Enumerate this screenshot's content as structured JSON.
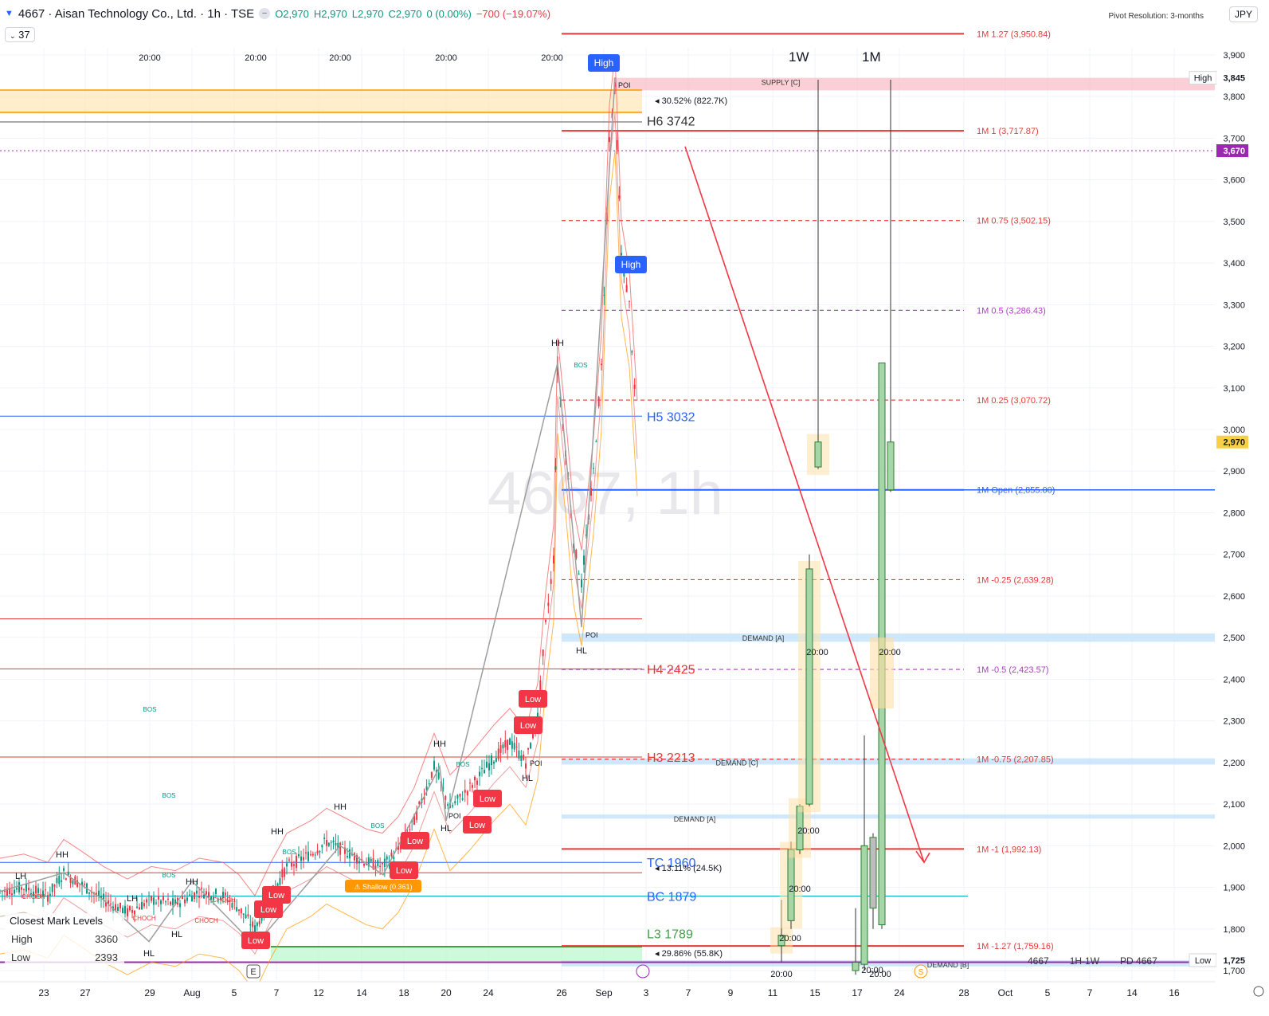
{
  "header": {
    "symbol": "4667 · Aisan Technology Co., Ltd. · 1h · TSE",
    "open": "O2,970",
    "high": "H2,970",
    "low": "L2,970",
    "close": "C2,970",
    "change": "0 (0.00%)",
    "volume_change": "−700 (−19.07%)",
    "indicator_count": "37",
    "pivot_resolution": "Pivot Resolution: 3-months",
    "currency": "JPY"
  },
  "timeframe_labels": [
    "1W",
    "1M"
  ],
  "watermark": "4667, 1h",
  "colors": {
    "up": "#089981",
    "down": "#f23645",
    "pivot_red": "#e53935",
    "pivot_purple": "#b03bc4",
    "open_blue": "#2962ff",
    "price_tag": "#f7d046"
  },
  "price_levels": [
    {
      "label": "1M 1.27 (3,950.84)",
      "price": 3950.84,
      "color": "#e53935",
      "style": "solid"
    },
    {
      "label": "1M 1 (3,717.87)",
      "price": 3717.87,
      "color": "#e53935",
      "style": "solid"
    },
    {
      "label": "1M 0.75 (3,502.15)",
      "price": 3502.15,
      "color": "#e53935",
      "style": "dashed"
    },
    {
      "label": "1M 0.5 (3,286.43)",
      "price": 3286.43,
      "color": "#b03bc4",
      "style": "dashed"
    },
    {
      "label": "1M 0.25 (3,070.72)",
      "price": 3070.72,
      "color": "#e53935",
      "style": "dashed"
    },
    {
      "label": "1M Open (2,855.00)",
      "price": 2855.0,
      "color": "#2962ff",
      "style": "solid"
    },
    {
      "label": "1M -0.25 (2,639.28)",
      "price": 2639.28,
      "color": "#e53935",
      "style": "dashed"
    },
    {
      "label": "1M -0.5 (2,423.57)",
      "price": 2423.57,
      "color": "#b03bc4",
      "style": "dashed"
    },
    {
      "label": "1M -0.75 (2,207.85)",
      "price": 2207.85,
      "color": "#e53935",
      "style": "dashed"
    },
    {
      "label": "1M -1 (1,992.13)",
      "price": 1992.13,
      "color": "#e53935",
      "style": "solid"
    },
    {
      "label": "1M -1.27 (1,759.16)",
      "price": 1759.16,
      "color": "#e53935",
      "style": "solid"
    }
  ],
  "h_levels": [
    {
      "label": "H6 3742",
      "price": 3742,
      "color": "#333333"
    },
    {
      "label": "H5 3032",
      "price": 3032,
      "color": "#2962ff"
    },
    {
      "label": "H4 2425",
      "price": 2425,
      "color": "#e53935"
    },
    {
      "label": "H3 2213",
      "price": 2213,
      "color": "#e53935"
    },
    {
      "label": "TC 1960",
      "price": 1960,
      "color": "#2962ff"
    },
    {
      "label": "BC 1879",
      "price": 1879,
      "color": "#2962ff"
    },
    {
      "label": "L3 1789",
      "price": 1789,
      "color": "#43a047"
    }
  ],
  "zones": [
    {
      "label": "SUPPLY [C]",
      "top": 3845,
      "bottom": 3815,
      "color": "#f8bbc4"
    },
    {
      "label": "DEMAND [A]",
      "top": 2510,
      "bottom": 2490,
      "color": "#bbdefb"
    },
    {
      "label": "DEMAND [C]",
      "top": 2210,
      "bottom": 2195,
      "color": "#bbdefb"
    },
    {
      "label": "DEMAND [A]",
      "top": 2075,
      "bottom": 2065,
      "color": "#bbdefb"
    },
    {
      "label": "DEMAND [B]",
      "top": 1725,
      "bottom": 1710,
      "color": "#bbdefb"
    }
  ],
  "annotations": {
    "pct_top": "◂ 30.52% (822.7K)",
    "pct_mid": "◂ 13.11% (24.5K)",
    "pct_bottom": "◂ 29.86% (55.8K)",
    "high_tag_1": "High",
    "high_tag_2": "High",
    "poi": "POI",
    "shallow": "⚠ Shallow (0.361)",
    "low_tag": "Low",
    "structure": [
      "HH",
      "HL",
      "LH",
      "BOS",
      "CHOCH"
    ]
  },
  "structure_labels": [
    {
      "text": "HH",
      "x": 700,
      "y": 434
    },
    {
      "text": "HL",
      "x": 730,
      "y": 820
    },
    {
      "text": "HH",
      "x": 552,
      "y": 937
    },
    {
      "text": "HL",
      "x": 662,
      "y": 980
    },
    {
      "text": "HL",
      "x": 560,
      "y": 1043
    },
    {
      "text": "HH",
      "x": 427,
      "y": 1016
    },
    {
      "text": "HH",
      "x": 348,
      "y": 1047
    },
    {
      "text": "HL",
      "x": 481,
      "y": 1117
    },
    {
      "text": "HH",
      "x": 78,
      "y": 1076
    },
    {
      "text": "HH",
      "x": 241,
      "y": 1110
    },
    {
      "text": "LH",
      "x": 26,
      "y": 1103
    },
    {
      "text": "LH",
      "x": 166,
      "y": 1131
    },
    {
      "text": "HL",
      "x": 222,
      "y": 1176
    },
    {
      "text": "HL",
      "x": 187,
      "y": 1200
    }
  ],
  "legend": {
    "title": "Closest Mark Levels",
    "rows": [
      {
        "name": "High",
        "value": "3360"
      },
      {
        "name": "Low",
        "value": "2393"
      }
    ]
  },
  "bottom_labels": [
    "4667",
    "1H-1W",
    "PD 4667"
  ],
  "chart_data": {
    "type": "candlestick",
    "title": "4667 · Aisan Technology Co., Ltd. · 1h · TSE",
    "ylim": [
      1690,
      3960
    ],
    "y_ticks": [
      "3,900",
      "3,800",
      "3,700",
      "3,600",
      "3,500",
      "3,400",
      "3,300",
      "3,200",
      "3,100",
      "3,000",
      "2,900",
      "2,800",
      "2,700",
      "2,600",
      "2,500",
      "2,400",
      "2,300",
      "2,200",
      "2,100",
      "2,000",
      "1,900",
      "1,800",
      "1,700"
    ],
    "x_ticks": [
      "23",
      "27",
      "29",
      "Aug",
      "5",
      "7",
      "12",
      "14",
      "18",
      "20",
      "24",
      "26",
      "Sep",
      "3",
      "7",
      "9",
      "11",
      "15",
      "17",
      "24",
      "28",
      "Oct",
      "5",
      "7",
      "14",
      "16"
    ],
    "time_ticks": [
      "20:00",
      "20:00",
      "20:00",
      "20:00",
      "20:00"
    ],
    "price_tags": [
      {
        "label": "High",
        "value": "3,845",
        "price": 3845,
        "bg": "#ffffff",
        "fg": "#131722"
      },
      {
        "label": "",
        "value": "3,670",
        "price": 3670,
        "bg": "#9c27b0",
        "fg": "#ffffff"
      },
      {
        "label": "",
        "value": "2,970",
        "price": 2970,
        "bg": "#f7d046",
        "fg": "#131722"
      },
      {
        "label": "Low",
        "value": "1,725",
        "price": 1725,
        "bg": "#ffffff",
        "fg": "#131722"
      }
    ],
    "hourly_close_path": [
      [
        0,
        1890
      ],
      [
        30,
        1900
      ],
      [
        60,
        1880
      ],
      [
        80,
        1935
      ],
      [
        100,
        1910
      ],
      [
        130,
        1870
      ],
      [
        160,
        1840
      ],
      [
        190,
        1870
      ],
      [
        220,
        1860
      ],
      [
        250,
        1890
      ],
      [
        280,
        1880
      ],
      [
        300,
        1850
      ],
      [
        320,
        1800
      ],
      [
        340,
        1880
      ],
      [
        360,
        1950
      ],
      [
        390,
        1980
      ],
      [
        410,
        2010
      ],
      [
        430,
        1990
      ],
      [
        460,
        1960
      ],
      [
        480,
        1950
      ],
      [
        500,
        1990
      ],
      [
        520,
        2060
      ],
      [
        545,
        2190
      ],
      [
        565,
        2090
      ],
      [
        590,
        2140
      ],
      [
        620,
        2210
      ],
      [
        640,
        2250
      ],
      [
        660,
        2200
      ],
      [
        675,
        2310
      ],
      [
        685,
        2530
      ],
      [
        695,
        2690
      ],
      [
        700,
        3140
      ],
      [
        710,
        2950
      ],
      [
        720,
        2730
      ],
      [
        730,
        2630
      ],
      [
        745,
        2900
      ],
      [
        755,
        3150
      ],
      [
        765,
        3700
      ],
      [
        772,
        3820
      ],
      [
        780,
        3420
      ],
      [
        790,
        3300
      ],
      [
        800,
        2990
      ]
    ],
    "weekly_candles": [
      {
        "label": "1W",
        "open": 1785,
        "high": 1870,
        "low": 1720,
        "close": 1760
      },
      {
        "label": "1W",
        "open": 1820,
        "high": 2010,
        "low": 1800,
        "close": 1990
      },
      {
        "label": "1W",
        "open": 1990,
        "high": 2100,
        "low": 1980,
        "close": 2095
      },
      {
        "label": "1W",
        "open": 2100,
        "high": 2700,
        "low": 2095,
        "close": 2665
      },
      {
        "label": "1W",
        "open": 2910,
        "high": 2975,
        "low": 2905,
        "close": 2970
      }
    ],
    "monthly_candles": [
      {
        "label": "1M",
        "open": 1700,
        "high": 1850,
        "low": 1690,
        "close": 1720
      },
      {
        "label": "1M",
        "open": 1715,
        "high": 2265,
        "low": 1700,
        "close": 2000
      },
      {
        "label": "1M",
        "open": 1850,
        "high": 2030,
        "low": 1800,
        "close": 2020
      },
      {
        "label": "1M",
        "open": 1810,
        "high": 3160,
        "low": 1800,
        "close": 3160
      },
      {
        "label": "1M",
        "open": 2855,
        "high": 3160,
        "low": 2850,
        "close": 2970
      }
    ],
    "forecast_arrow": {
      "from_price": 3680,
      "to_price": 1960
    },
    "axis_label_precision": 0
  }
}
